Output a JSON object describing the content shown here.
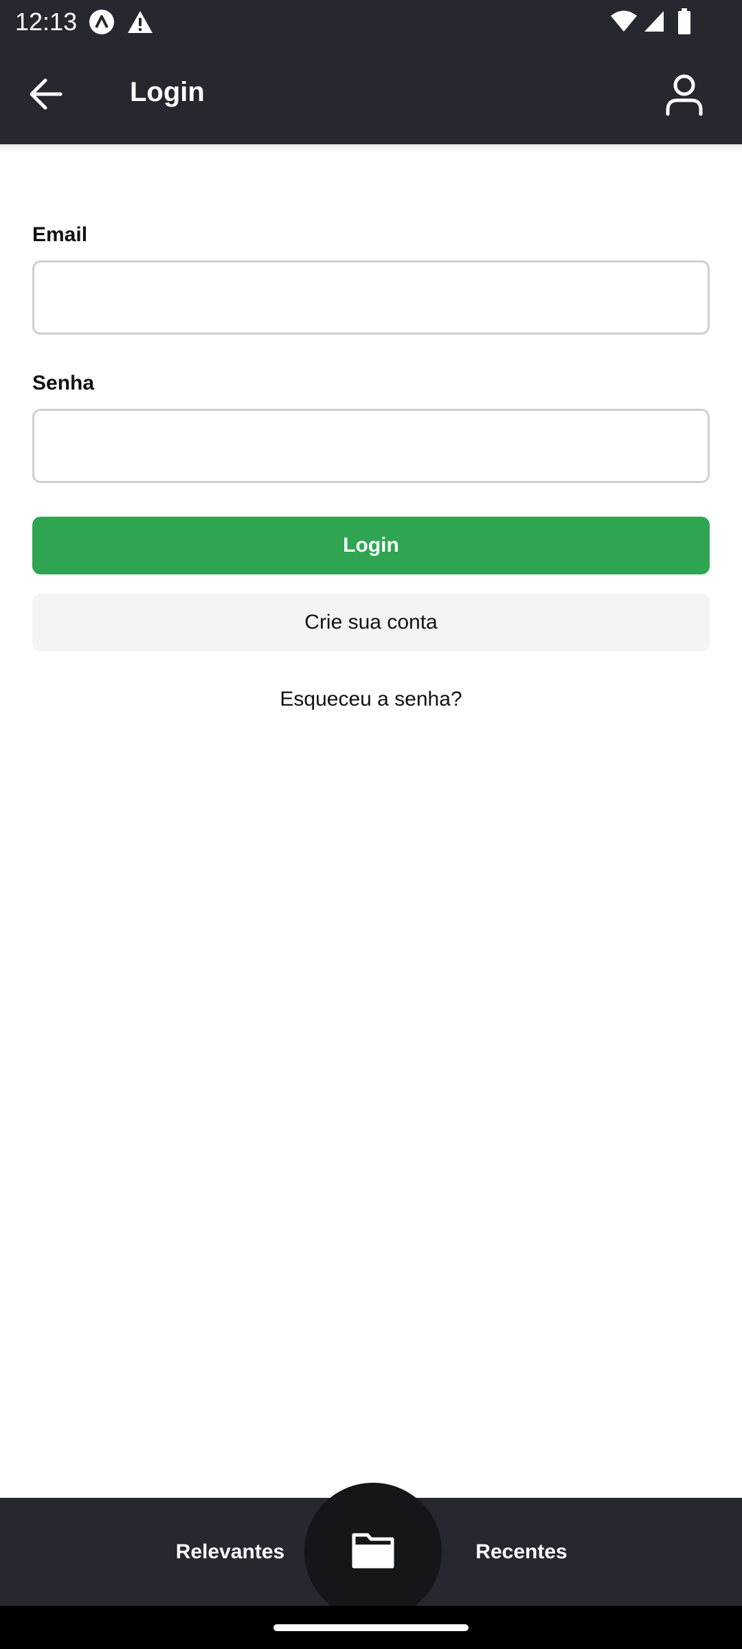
{
  "status_bar": {
    "time": "12:13",
    "icons": [
      "app-notification-icon",
      "warning-icon",
      "wifi-icon",
      "signal-icon",
      "battery-icon"
    ]
  },
  "app_bar": {
    "title": "Login",
    "back_icon": "arrow-left-icon",
    "account_icon": "user-icon",
    "background": "#25292f"
  },
  "form": {
    "email_label": "Email",
    "email_value": "",
    "email_placeholder": "",
    "password_label": "Senha",
    "password_value": "",
    "password_placeholder": "",
    "login_button": "Login",
    "signup_button": "Crie sua conta",
    "forgot_link": "Esqueceu a senha?"
  },
  "tab_bar": {
    "left_tab": "Relevantes",
    "right_tab": "Recentes",
    "center_icon": "folder-icon"
  },
  "colors": {
    "primary_green": "#2fa552",
    "dark_bar": "#25292f",
    "secondary_button": "#f4f4f4",
    "fab": "#141619"
  }
}
